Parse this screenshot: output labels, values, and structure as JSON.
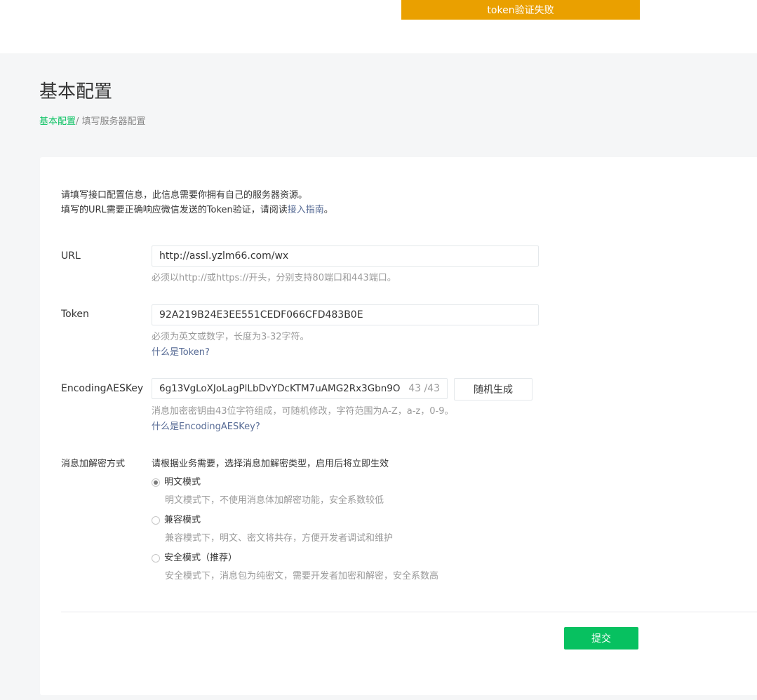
{
  "toast": {
    "message": "token验证失败"
  },
  "page": {
    "title": "基本配置",
    "breadcrumb": {
      "home": "基本配置",
      "separator": "/ ",
      "current": "填写服务器配置"
    }
  },
  "intro": {
    "line1": "请填写接口配置信息，此信息需要你拥有自己的服务器资源。",
    "line2_prefix": "填写的URL需要正确响应微信发送的Token验证，请阅读",
    "line2_link": "接入指南",
    "line2_suffix": "。"
  },
  "form": {
    "url": {
      "label": "URL",
      "value": "http://assl.yzlm66.com/wx",
      "hint": "必须以http://或https://开头，分别支持80端口和443端口。"
    },
    "token": {
      "label": "Token",
      "value": "92A219B24E3EE551CEDF066CFD483B0E",
      "hint": "必须为英文或数字，长度为3-32字符。",
      "help_link": "什么是Token?"
    },
    "aes_key": {
      "label": "EncodingAESKey",
      "value": "6g13VgLoXJoLagPlLbDvYDcKTM7uAMG2Rx3Gbn9O",
      "counter": "43 /43",
      "generate_button": "随机生成",
      "hint": "消息加密密钥由43位字符组成，可随机修改，字符范围为A-Z，a-z，0-9。",
      "help_link": "什么是EncodingAESKey?"
    },
    "encryption_mode": {
      "label": "消息加解密方式",
      "description": "请根据业务需要，选择消息加解密类型，启用后将立即生效",
      "options": [
        {
          "label": "明文模式",
          "desc": "明文模式下，不使用消息体加解密功能，安全系数较低",
          "selected": true
        },
        {
          "label": "兼容模式",
          "desc": "兼容模式下，明文、密文将共存，方便开发者调试和维护",
          "selected": false
        },
        {
          "label": "安全模式（推荐）",
          "desc": "安全模式下，消息包为纯密文，需要开发者加密和解密，安全系数高",
          "selected": false
        }
      ]
    },
    "submit_button": "提交"
  }
}
